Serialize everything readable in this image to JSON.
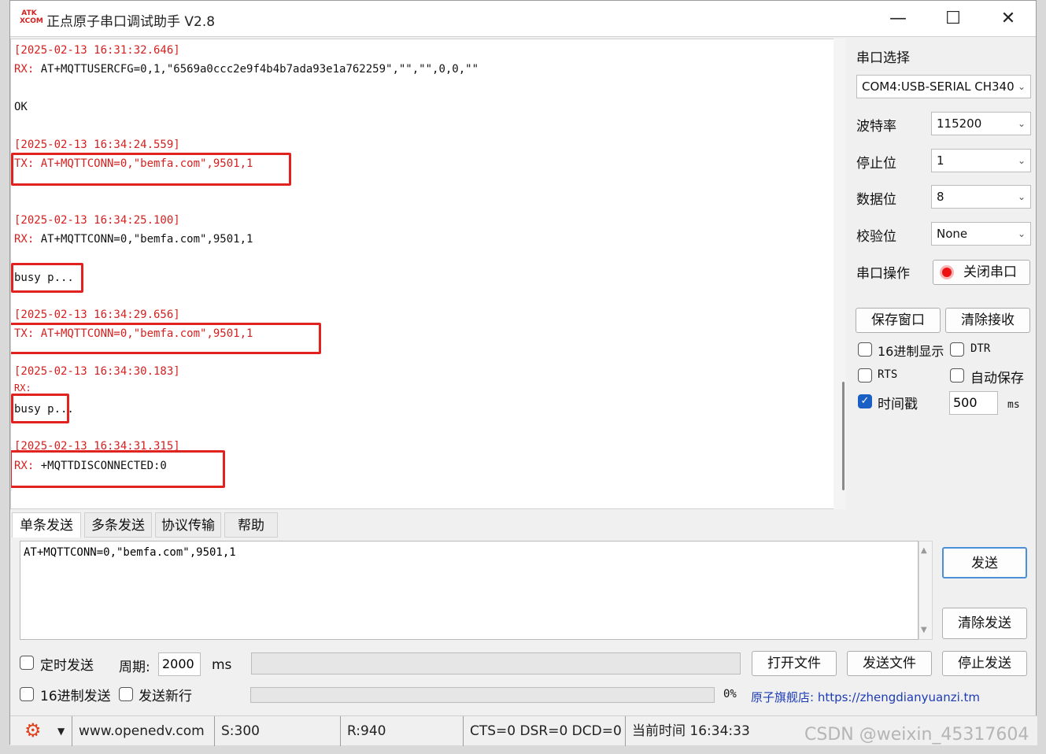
{
  "app": {
    "title": "正点原子串口调试助手 V2.8",
    "logo_text": "ATK XCOM"
  },
  "log": {
    "lines": [
      {
        "text": "[2025-02-13 16:31:32.646]",
        "color": "red"
      },
      {
        "prefix": "RX: ",
        "text": "AT+MQTTUSERCFG=0,1,\"6569a0ccc2e9f4b4b7ada93e1a762259\",\"\",\"\",0,0,\"\""
      },
      {
        "text": "OK"
      },
      {
        "text": "[2025-02-13 16:34:24.559]",
        "color": "red"
      },
      {
        "prefix": "TX: ",
        "text": "AT+MQTTCONN=0,\"bemfa.com\",9501,1",
        "color": "red"
      },
      {
        "text": "[2025-02-13 16:34:25.100]",
        "color": "red"
      },
      {
        "prefix": "RX: ",
        "text": "AT+MQTTCONN=0,\"bemfa.com\",9501,1"
      },
      {
        "text": "busy p..."
      },
      {
        "text": "[2025-02-13 16:34:29.656]",
        "color": "red"
      },
      {
        "prefix": "TX: ",
        "text": "AT+MQTTCONN=0,\"bemfa.com\",9501,1",
        "color": "red"
      },
      {
        "text": "[2025-02-13 16:34:30.183]",
        "color": "red"
      },
      {
        "prefix": "RX:",
        "text": ""
      },
      {
        "text": "busy p..."
      },
      {
        "text": "[2025-02-13 16:34:31.315]",
        "color": "red"
      },
      {
        "prefix": "RX: ",
        "text": "+MQTTDISCONNECTED:0"
      }
    ]
  },
  "panel": {
    "port_label": "串口选择",
    "port_value": "COM4:USB-SERIAL CH340",
    "baud_label": "波特率",
    "baud_value": "115200",
    "stop_label": "停止位",
    "stop_value": "1",
    "data_label": "数据位",
    "data_value": "8",
    "parity_label": "校验位",
    "parity_value": "None",
    "op_label": "串口操作",
    "close_port": "关闭串口",
    "save_window": "保存窗口",
    "clear_recv": "清除接收",
    "hex_display": "16进制显示",
    "dtr": "DTR",
    "rts": "RTS",
    "auto_save": "自动保存",
    "timestamp": "时间戳",
    "timestamp_value": "500",
    "ms": "ms"
  },
  "tabs": [
    "单条发送",
    "多条发送",
    "协议传输",
    "帮助"
  ],
  "send": {
    "text": "AT+MQTTCONN=0,\"bemfa.com\",9501,1",
    "send_btn": "发送",
    "clear_send": "清除发送",
    "timed_send": "定时发送",
    "period_label": "周期:",
    "period_value": "2000",
    "period_unit": "ms",
    "open_file": "打开文件",
    "send_file": "发送文件",
    "stop_send": "停止发送",
    "hex_send": "16进制发送",
    "send_newline": "发送新行",
    "progress": "0%",
    "progress_value": 0,
    "store_link": "原子旗舰店: https://zhengdianyuanzi.tm"
  },
  "status": {
    "site": "www.openedv.com",
    "sent": "S:300",
    "recv": "R:940",
    "lines": "CTS=0 DSR=0 DCD=0",
    "time": "当前时间 16:34:33"
  },
  "watermark": "CSDN @weixin_45317604",
  "colors": {
    "log_red": "#d6201f",
    "highlight": "#e0231f",
    "check_on": "#1a5fc4",
    "link": "#1d3bb5"
  }
}
